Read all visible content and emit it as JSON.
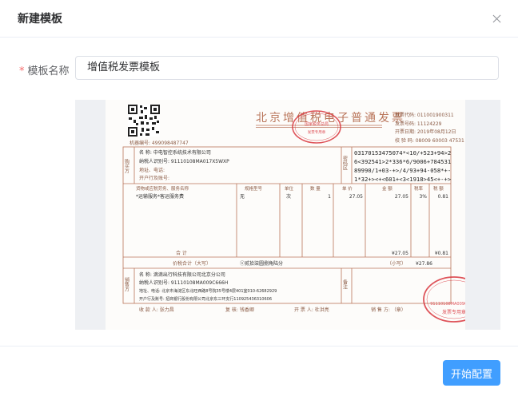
{
  "dialog": {
    "title": "新建模板",
    "close_icon": "close-icon"
  },
  "form": {
    "required_mark": "*",
    "name_label": "模板名称",
    "name_value": "增值税发票模板"
  },
  "invoice": {
    "title": "北京增值税电子普通发票",
    "qr_icon": "qr-code-icon",
    "meta": {
      "code": "发票代码: 011001900311",
      "number": "发票号码: 11124229",
      "date": "开票日期: 2019年08月12日",
      "check": "校 验 码: 08009 60003 47531 55374"
    },
    "machine_no": "机器编号: 499098487747",
    "buyer": {
      "side_label": "购买方",
      "name": "名 称: 中电智控系统技术有限公司",
      "tax_id": "纳税人识别号: 91110108MA017X5WXP",
      "address": "地址、电话:",
      "bank": "开户行及账号:"
    },
    "cipher_label": "密码区",
    "cipher_lines": [
      "03170153475074*<10/+523+94>2",
      "6<392541>2*336*6/9006+784531",
      "89990/1+03-+>/4/93+94-058*+-",
      "1*32+><+<601+<3<1918>45<+-+>"
    ],
    "columns": [
      "货物或应税劳务、服务名称",
      "规格型号",
      "单位",
      "数 量",
      "单 价",
      "金 额",
      "税率",
      "税 额"
    ],
    "item": {
      "name": "*运输服务*客运服务费",
      "spec": "无",
      "unit": "次",
      "qty": "1",
      "price": "27.05",
      "amount": "27.05",
      "rate": "3%",
      "tax": "0.81"
    },
    "total_label": "合 计",
    "total_amount": "¥27.05",
    "total_tax": "¥0.81",
    "grand_label": "价税合计（大写）",
    "grand_words": "ⓧ贰拾柒圆捌角陆分",
    "grand_small_label": "（小写）",
    "grand_small": "¥27.86",
    "seller": {
      "side_label": "销售方",
      "name": "名 称: 滴滴出行科技有限公司北京分公司",
      "tax_id": "纳税人识别号: 91110108MA009C666H",
      "address": "地址、电话: 北京市海淀区东北旺西路8号院35号楼4层401室010-62682929",
      "bank": "开户行及账号: 招商银行股份有限公司北京东三环支行110925436310606"
    },
    "remark_label": "备注",
    "footer": {
      "payee": "收 款 人: 张力昌",
      "reviewer": "复 核: 钱香卿",
      "drawer": "开 票 人: 杜洪亮",
      "seller": "销 售 方: （章）"
    },
    "stamp_top_text": "国家税务总局",
    "stamp_bottom_text": "发票专用章",
    "stamp_id": "91110108MA009C666H",
    "stamp_color": "#d9363e",
    "border_color": "#b9755a"
  },
  "footer": {
    "start_button": "开始配置"
  },
  "colors": {
    "primary": "#409eff",
    "required": "#f56c6c",
    "border": "#dcdfe6"
  }
}
